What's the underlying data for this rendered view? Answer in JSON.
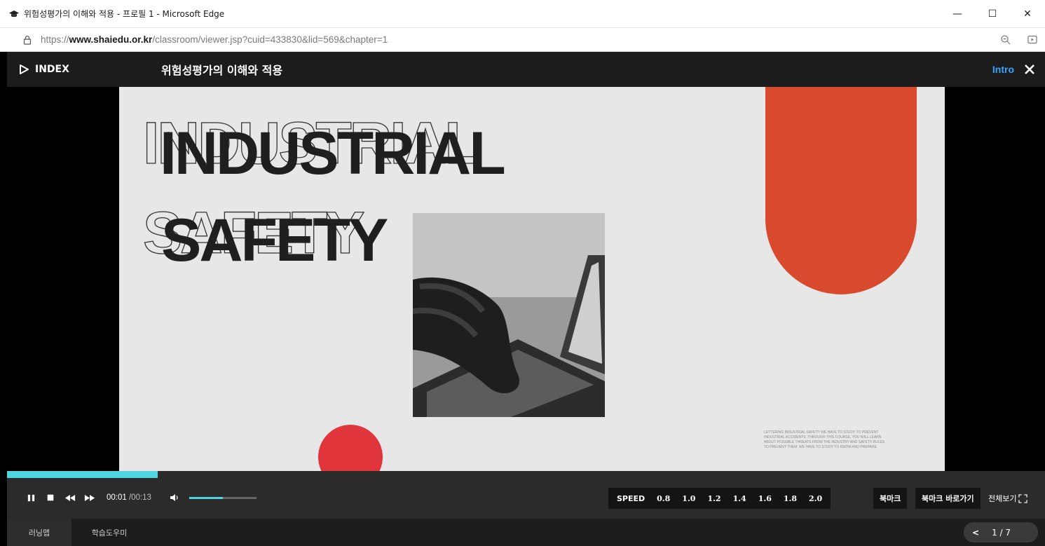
{
  "window": {
    "title": "위험성평가의 이해와 적용 - 프로필 1 - Microsoft Edge",
    "controls": [
      "—",
      "☐",
      "✕"
    ]
  },
  "address": {
    "url_prefix": "https://",
    "url_domain": "www.shaiedu.or.kr",
    "url_path": "/classroom/viewer.jsp?cuid=433830&lid=569&chapter=1"
  },
  "viewer": {
    "index_label": "INDEX",
    "course_title": "위험성평가의 이해와 적용",
    "intro_label": "Intro"
  },
  "slide": {
    "headline_line1": "INDUSTRIAL",
    "headline_line2": "SAFETY",
    "body_text": "LETTERING INDUSTRIAL SAFETY WE HAVE TO STUDY TO PREVENT INDUSTRIAL ACCIDENTS. THROUGH THIS COURSE, YOU WILL LEARN ABOUT POSSIBLE THREATS FROM THE INDUSTRY AND SAFETY RULES TO PREVENT THEM. WE HAVE TO STUDY TO KNOW AND PREPARE.",
    "colors": {
      "accent_orange": "#d8492d",
      "accent_red": "#e0353a"
    }
  },
  "player": {
    "progress_fraction": 0.145,
    "time_current": "00:01",
    "time_total": "/00:13",
    "volume_fraction": 0.5,
    "speed_label": "SPEED",
    "speeds": [
      "0.8",
      "1.0",
      "1.2",
      "1.4",
      "1.6",
      "1.8",
      "2.0"
    ],
    "bookmark": "북마크",
    "bookmark_goto": "북마크 바로가기",
    "fullscreen": "전체보기",
    "accent": "#4fd4e2"
  },
  "bottom": {
    "tabs": [
      "러닝맵",
      "학습도우미"
    ],
    "pager_prev": "<",
    "pager": "1 / 7"
  }
}
